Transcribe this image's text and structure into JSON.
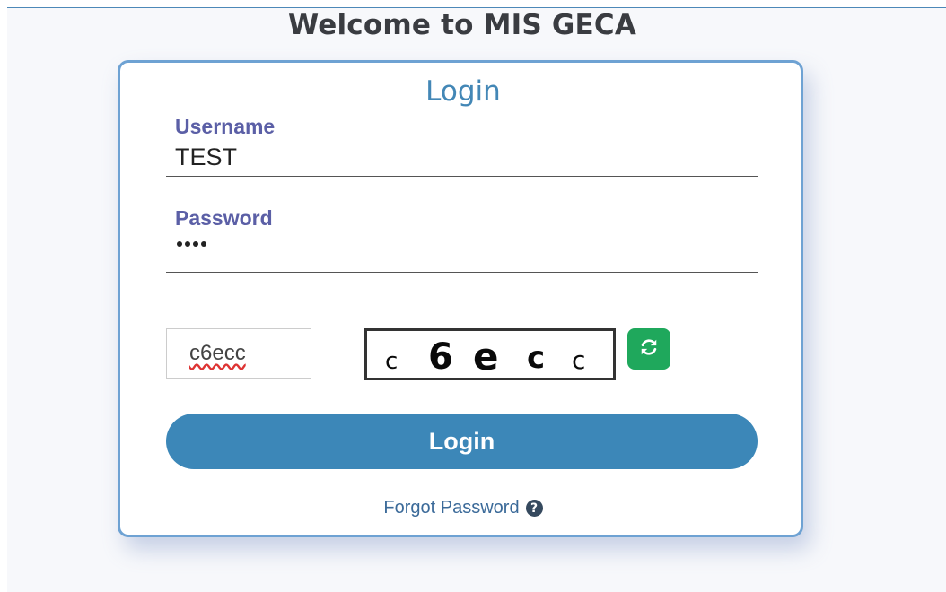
{
  "header": {
    "title": "Welcome to MIS GECA"
  },
  "login_card": {
    "title": "Login",
    "username": {
      "label": "Username",
      "value": "TEST"
    },
    "password": {
      "label": "Password",
      "masked_length": 4
    },
    "captcha": {
      "input_value": "c6ecc",
      "image_chars": [
        "c",
        "6",
        "e",
        "c",
        "c"
      ],
      "refresh_icon": "refresh-icon",
      "refresh_color": "#1fa85c"
    },
    "login_button_label": "Login",
    "forgot_password_label": "Forgot Password",
    "forgot_password_icon": "question-circle-icon"
  },
  "colors": {
    "accent": "#3c87b8",
    "card_border": "#6ea2d3",
    "label": "#5b5fa6",
    "link": "#3b6a99"
  }
}
